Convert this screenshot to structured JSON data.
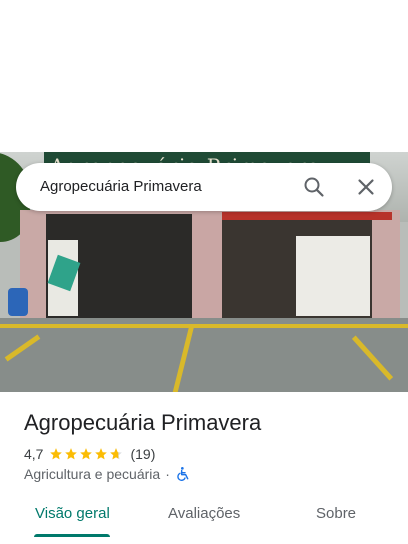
{
  "search": {
    "query": "Agropecuária Primavera",
    "search_icon": "search-icon",
    "close_icon": "close-icon"
  },
  "photo": {
    "sign_text": "Agropecuária Primavera",
    "description_icon": "storefront-photo"
  },
  "place": {
    "name": "Agropecuária Primavera",
    "rating": "4,7",
    "rating_value": 4.7,
    "stars_out_of": 5,
    "review_count": "(19)",
    "category": "Agricultura e pecuária",
    "separator": "·",
    "accessibility_icon": "wheelchair-icon"
  },
  "tabs": [
    {
      "label": "Visão geral",
      "active": true
    },
    {
      "label": "Avaliações",
      "active": false
    },
    {
      "label": "Sobre",
      "active": false
    }
  ],
  "colors": {
    "accent": "#00796b",
    "star": "#fbbc04",
    "wheelchair": "#1a73e8",
    "text_primary": "#202124",
    "text_secondary": "#5f6368"
  }
}
